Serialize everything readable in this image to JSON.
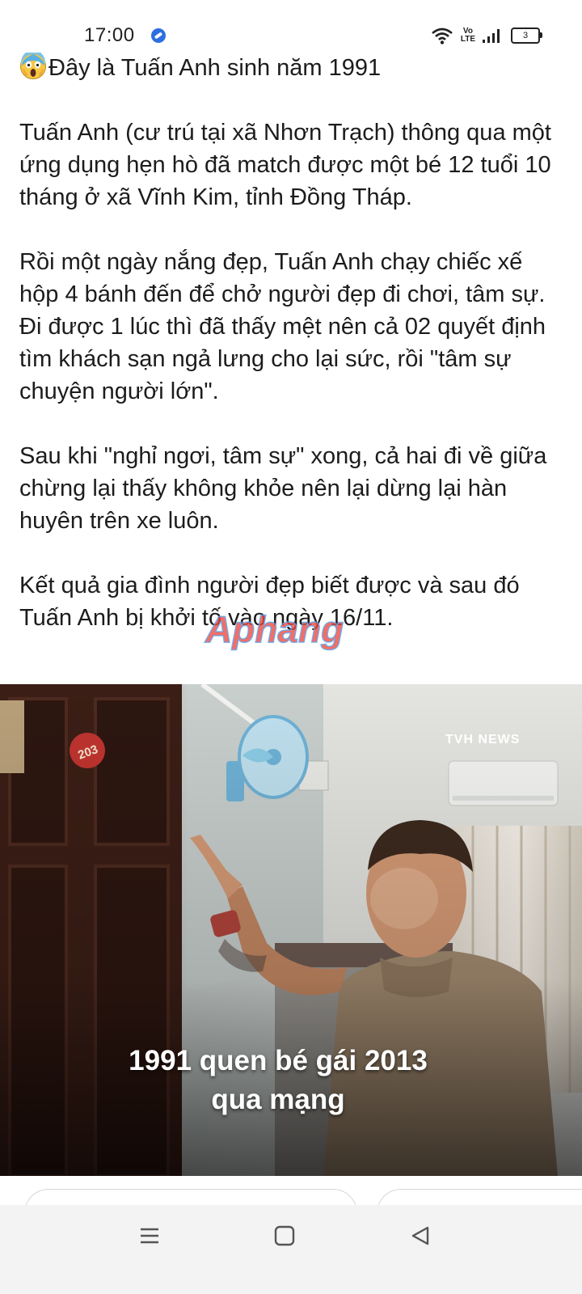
{
  "status_bar": {
    "time": "17:00",
    "volte_top": "Vo",
    "volte_bottom": "LTE",
    "battery": "3"
  },
  "post": {
    "emoji": "face-screaming-in-fear",
    "paragraphs": [
      "Đây là Tuấn Anh sinh năm 1991",
      "Tuấn Anh (cư trú tại xã Nhơn Trạch) thông qua một ứng dụng hẹn hò đã match được một bé 12 tuổi 10 tháng ở xã Vĩnh Kim, tỉnh Đồng Tháp.",
      "Rồi một ngày nắng đẹp, Tuấn Anh chạy chiếc xế hộp 4 bánh đến để chở người đẹp đi chơi, tâm sự. Đi được 1 lúc thì đã thấy mệt nên cả 02 quyết định tìm khách sạn ngả lưng cho lại sức, rồi \"tâm sự chuyện người lớn\".",
      "Sau khi \"nghỉ ngơi, tâm sự\" xong, cả hai đi về giữa chừng lại thấy không khỏe nên lại dừng lại hàn huyên trên xe luôn.",
      "Kết quả gia đình người đẹp biết được và sau đó Tuấn Anh bị khởi tố vào ngày 16/11."
    ],
    "watermark": "Aphang"
  },
  "media": {
    "source_label": "TVH NEWS",
    "door_number": "203",
    "caption_line1": "1991 quen bé gái 2013",
    "caption_line2": "qua mạng"
  },
  "nav": {
    "menu_icon": "menu-icon",
    "home_icon": "home-square-icon",
    "back_icon": "back-triangle-icon"
  }
}
